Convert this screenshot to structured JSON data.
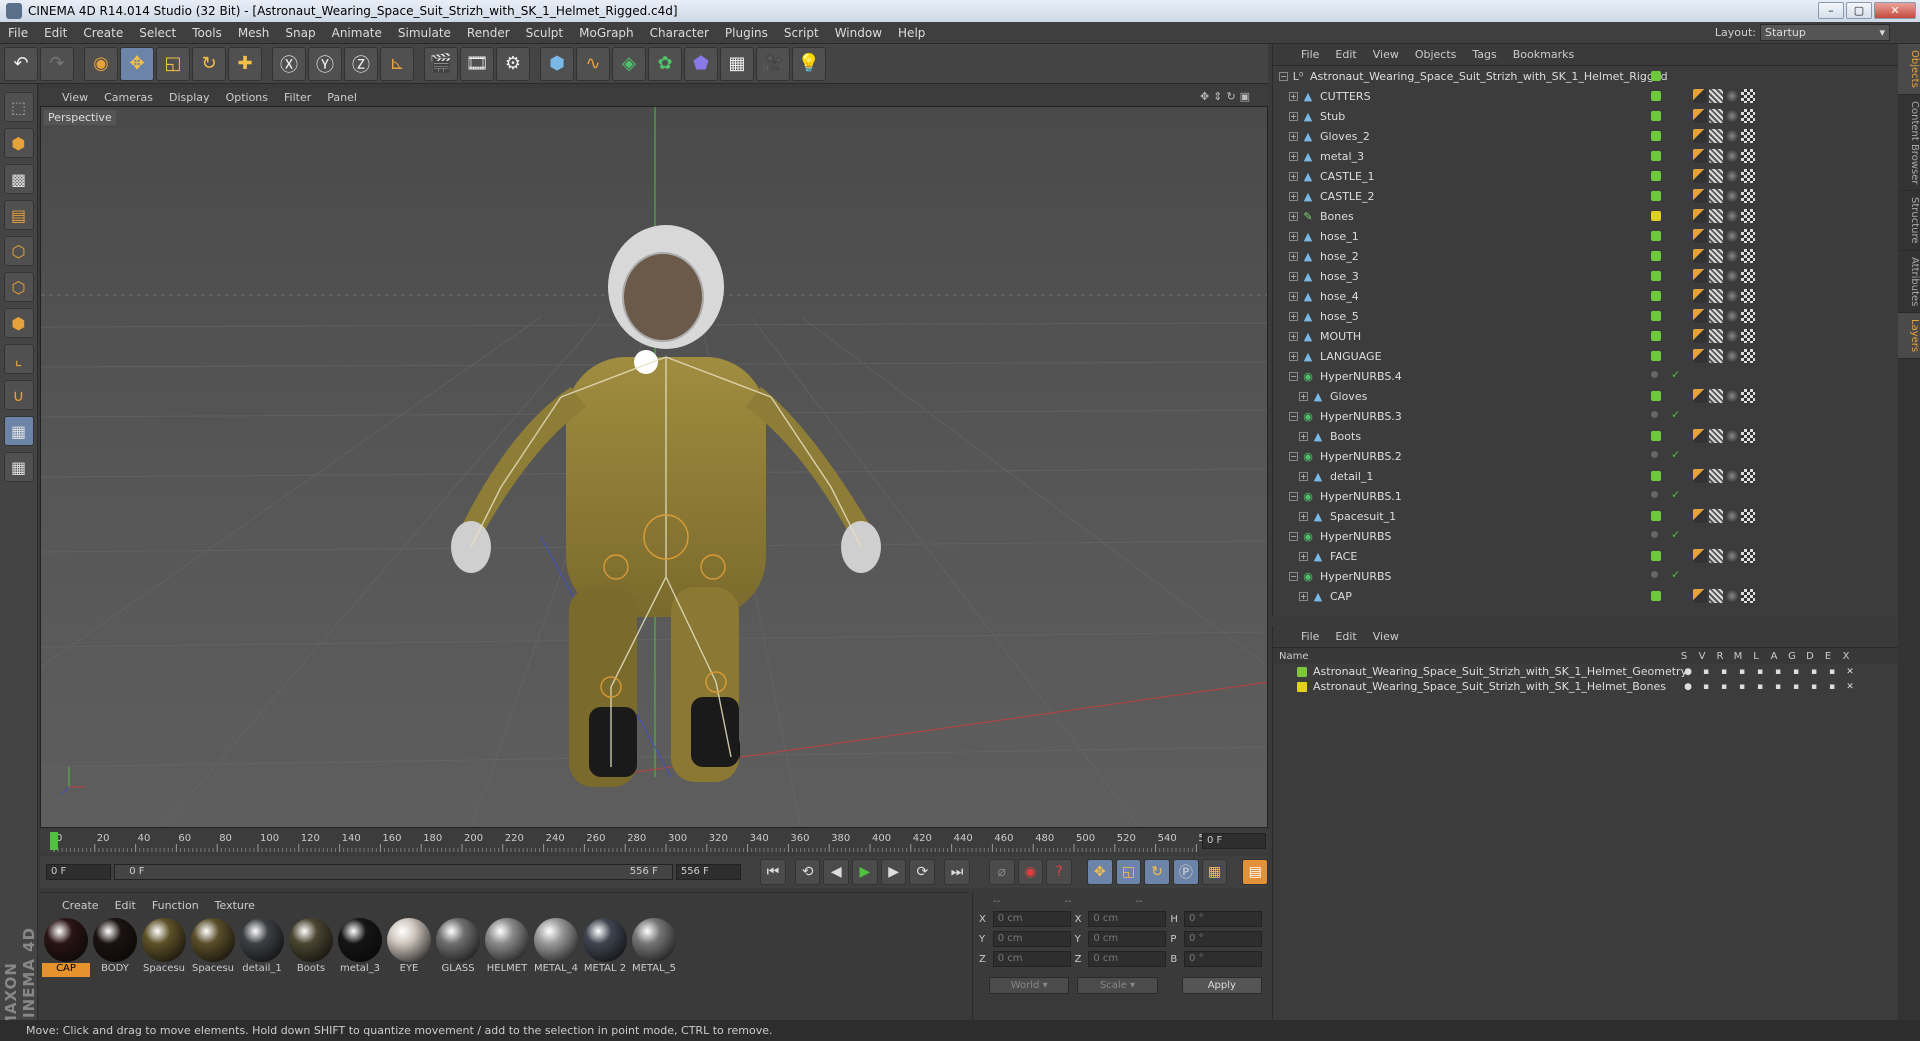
{
  "window": {
    "title": "CINEMA 4D R14.014 Studio (32 Bit) - [Astronaut_Wearing_Space_Suit_Strizh_with_SK_1_Helmet_Rigged.c4d]"
  },
  "menu": [
    "File",
    "Edit",
    "Create",
    "Select",
    "Tools",
    "Mesh",
    "Snap",
    "Animate",
    "Simulate",
    "Render",
    "Sculpt",
    "MoGraph",
    "Character",
    "Plugins",
    "Script",
    "Window",
    "Help"
  ],
  "layout": {
    "label": "Layout:",
    "value": "Startup"
  },
  "viewport": {
    "menu": [
      "View",
      "Cameras",
      "Display",
      "Options",
      "Filter",
      "Panel"
    ],
    "label": "Perspective"
  },
  "timeline": {
    "ticks": [
      "0",
      "20",
      "40",
      "60",
      "80",
      "100",
      "120",
      "140",
      "160",
      "180",
      "200",
      "220",
      "240",
      "260",
      "280",
      "300",
      "320",
      "340",
      "360",
      "380",
      "400",
      "420",
      "440",
      "460",
      "480",
      "500",
      "520",
      "540",
      "5"
    ],
    "current": "0 F",
    "start": "0 F",
    "range_start": "0 F",
    "range_end": "556 F",
    "end": "556 F"
  },
  "materials": {
    "menu": [
      "Create",
      "Edit",
      "Function",
      "Texture"
    ],
    "items": [
      {
        "name": "CAP",
        "color": "#2a1414",
        "active": true
      },
      {
        "name": "BODY",
        "color": "#1c1212"
      },
      {
        "name": "Spacesu",
        "color": "#5e5128"
      },
      {
        "name": "Spacesu",
        "color": "#5a4e2a"
      },
      {
        "name": "detail_1",
        "color": "#3d3f44"
      },
      {
        "name": "Boots",
        "color": "#4b4530"
      },
      {
        "name": "metal_3",
        "color": "#151515"
      },
      {
        "name": "EYE",
        "color": "#cfc6be"
      },
      {
        "name": "GLASS",
        "color": "#6f6f6f"
      },
      {
        "name": "HELMET",
        "color": "#8a8a8a"
      },
      {
        "name": "METAL_4",
        "color": "#9a9a9a"
      },
      {
        "name": "METAL 2",
        "color": "#3f4550"
      },
      {
        "name": "METAL_5",
        "color": "#767676"
      }
    ]
  },
  "coords": {
    "headers": [
      "--",
      "--",
      "--"
    ],
    "rows": [
      {
        "a1": "X",
        "v1": "0 cm",
        "a2": "X",
        "v2": "0 cm",
        "a3": "H",
        "v3": "0 °"
      },
      {
        "a1": "Y",
        "v1": "0 cm",
        "a2": "Y",
        "v2": "0 cm",
        "a3": "P",
        "v3": "0 °"
      },
      {
        "a1": "Z",
        "v1": "0 cm",
        "a2": "Z",
        "v2": "0 cm",
        "a3": "B",
        "v3": "0 °"
      }
    ],
    "mode1": "World",
    "mode2": "Scale",
    "apply": "Apply"
  },
  "status": "Move: Click and drag to move elements. Hold down SHIFT to quantize movement / add to the selection in point mode, CTRL to remove.",
  "objects": {
    "menu": [
      "File",
      "Edit",
      "View",
      "Objects",
      "Tags",
      "Bookmarks"
    ],
    "root": "Astronaut_Wearing_Space_Suit_Strizh_with_SK_1_Helmet_Rigged",
    "items": [
      {
        "name": "CUTTERS",
        "level": 1,
        "type": "poly"
      },
      {
        "name": "Stub",
        "level": 1,
        "type": "poly"
      },
      {
        "name": "Gloves_2",
        "level": 1,
        "type": "poly"
      },
      {
        "name": "metal_3",
        "level": 1,
        "type": "poly"
      },
      {
        "name": "CASTLE_1",
        "level": 1,
        "type": "poly"
      },
      {
        "name": "CASTLE_2",
        "level": 1,
        "type": "poly"
      },
      {
        "name": "Bones",
        "level": 1,
        "type": "bone"
      },
      {
        "name": "hose_1",
        "level": 1,
        "type": "poly"
      },
      {
        "name": "hose_2",
        "level": 1,
        "type": "poly"
      },
      {
        "name": "hose_3",
        "level": 1,
        "type": "poly"
      },
      {
        "name": "hose_4",
        "level": 1,
        "type": "poly"
      },
      {
        "name": "hose_5",
        "level": 1,
        "type": "poly"
      },
      {
        "name": "MOUTH",
        "level": 1,
        "type": "poly"
      },
      {
        "name": "LANGUAGE",
        "level": 1,
        "type": "poly"
      },
      {
        "name": "HyperNURBS.4",
        "level": 1,
        "type": "nurbs"
      },
      {
        "name": "Gloves",
        "level": 2,
        "type": "poly"
      },
      {
        "name": "HyperNURBS.3",
        "level": 1,
        "type": "nurbs"
      },
      {
        "name": "Boots",
        "level": 2,
        "type": "poly"
      },
      {
        "name": "HyperNURBS.2",
        "level": 1,
        "type": "nurbs"
      },
      {
        "name": "detail_1",
        "level": 2,
        "type": "poly"
      },
      {
        "name": "HyperNURBS.1",
        "level": 1,
        "type": "nurbs"
      },
      {
        "name": "Spacesuit_1",
        "level": 2,
        "type": "poly"
      },
      {
        "name": "HyperNURBS",
        "level": 1,
        "type": "nurbs"
      },
      {
        "name": "FACE",
        "level": 2,
        "type": "poly"
      },
      {
        "name": "HyperNURBS",
        "level": 1,
        "type": "nurbs"
      },
      {
        "name": "CAP",
        "level": 2,
        "type": "poly"
      }
    ]
  },
  "layers": {
    "menu": [
      "File",
      "Edit",
      "View"
    ],
    "columns": [
      "Name",
      "S",
      "V",
      "R",
      "M",
      "L",
      "A",
      "G",
      "D",
      "E",
      "X"
    ],
    "items": [
      {
        "name": "Astronaut_Wearing_Space_Suit_Strizh_with_SK_1_Helmet_Geometry",
        "color": "#7fc63c"
      },
      {
        "name": "Astronaut_Wearing_Space_Suit_Strizh_with_SK_1_Helmet_Bones",
        "color": "#e3d21c"
      }
    ]
  },
  "side_tabs": [
    "Objects",
    "Content Browser",
    "Structure",
    "Attributes",
    "Layers"
  ],
  "colors": {
    "accent": "#e6932e",
    "green_dot": "#6cc93a",
    "yellow_dot": "#e0d11e"
  }
}
